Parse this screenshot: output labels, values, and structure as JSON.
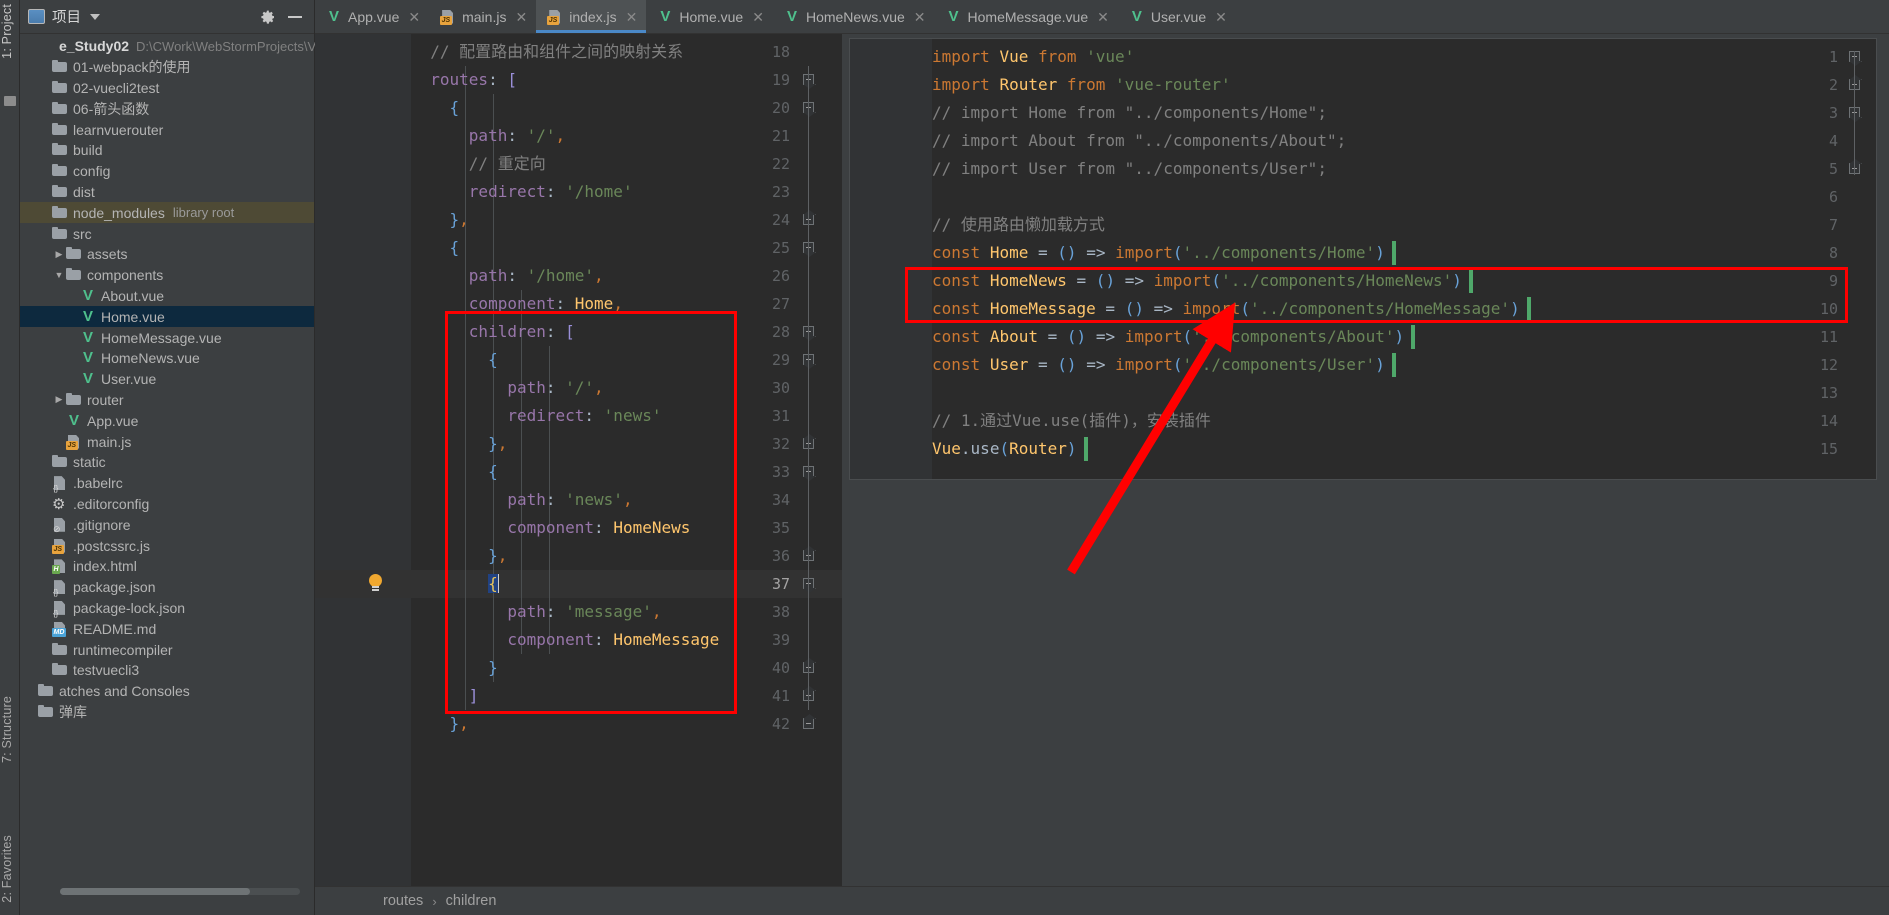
{
  "left_strip": {
    "project_tab": "1: Project",
    "structure_tab": "7: Structure",
    "favorites_tab": "2: Favorites"
  },
  "project_panel": {
    "title": "项目",
    "icons": {
      "project": "project-icon",
      "caret": "chevron-down-icon",
      "settings": "gear-icon",
      "hide": "minimize-icon"
    },
    "tree": [
      {
        "label": "e_Study02",
        "note": "D:\\CWork\\WebStormProjects\\Vue_Stu",
        "icon": "folder-icon",
        "indent": 0,
        "arrow": "",
        "kind": "root"
      },
      {
        "label": "01-webpack的使用",
        "icon": "folder-icon",
        "indent": 1,
        "arrow": "",
        "kind": "folder"
      },
      {
        "label": "02-vuecli2test",
        "icon": "folder-icon",
        "indent": 1,
        "arrow": "",
        "kind": "folder"
      },
      {
        "label": "06-箭头函数",
        "icon": "folder-icon",
        "indent": 1,
        "arrow": "",
        "kind": "folder"
      },
      {
        "label": "learnvuerouter",
        "icon": "folder-icon",
        "indent": 1,
        "arrow": "",
        "kind": "folder"
      },
      {
        "label": "build",
        "icon": "folder-icon",
        "indent": 1,
        "arrow": "",
        "kind": "folder"
      },
      {
        "label": "config",
        "icon": "folder-icon",
        "indent": 1,
        "arrow": "",
        "kind": "folder"
      },
      {
        "label": "dist",
        "icon": "folder-icon",
        "indent": 1,
        "arrow": "",
        "kind": "folder"
      },
      {
        "label": "node_modules",
        "note": "library root",
        "icon": "folder-icon",
        "indent": 1,
        "arrow": "",
        "kind": "library"
      },
      {
        "label": "src",
        "icon": "folder-icon",
        "indent": 1,
        "arrow": "",
        "kind": "folder"
      },
      {
        "label": "assets",
        "icon": "folder-icon",
        "indent": 2,
        "arrow": "▶",
        "kind": "folder"
      },
      {
        "label": "components",
        "icon": "folder-icon",
        "indent": 2,
        "arrow": "▼",
        "kind": "folder"
      },
      {
        "label": "About.vue",
        "icon": "vue-icon",
        "indent": 3,
        "arrow": "",
        "kind": "vue"
      },
      {
        "label": "Home.vue",
        "icon": "vue-icon",
        "indent": 3,
        "arrow": "",
        "kind": "vue",
        "selected": true
      },
      {
        "label": "HomeMessage.vue",
        "icon": "vue-icon",
        "indent": 3,
        "arrow": "",
        "kind": "vue"
      },
      {
        "label": "HomeNews.vue",
        "icon": "vue-icon",
        "indent": 3,
        "arrow": "",
        "kind": "vue"
      },
      {
        "label": "User.vue",
        "icon": "vue-icon",
        "indent": 3,
        "arrow": "",
        "kind": "vue"
      },
      {
        "label": "router",
        "icon": "folder-icon",
        "indent": 2,
        "arrow": "▶",
        "kind": "folder"
      },
      {
        "label": "App.vue",
        "icon": "vue-icon",
        "indent": 2,
        "arrow": "",
        "kind": "vue"
      },
      {
        "label": "main.js",
        "icon": "js-file-icon",
        "indent": 2,
        "arrow": "",
        "kind": "js"
      },
      {
        "label": "static",
        "icon": "folder-icon",
        "indent": 1,
        "arrow": "",
        "kind": "folder"
      },
      {
        "label": ".babelrc",
        "icon": "json-file-icon",
        "indent": 1,
        "arrow": "",
        "kind": "json"
      },
      {
        "label": ".editorconfig",
        "icon": "gear-file-icon",
        "indent": 1,
        "arrow": "",
        "kind": "gear"
      },
      {
        "label": ".gitignore",
        "icon": "gitignore-file-icon",
        "indent": 1,
        "arrow": "",
        "kind": "gitignore"
      },
      {
        "label": ".postcssrc.js",
        "icon": "js-file-icon",
        "indent": 1,
        "arrow": "",
        "kind": "js"
      },
      {
        "label": "index.html",
        "icon": "html-file-icon",
        "indent": 1,
        "arrow": "",
        "kind": "html"
      },
      {
        "label": "package.json",
        "icon": "json-file-icon",
        "indent": 1,
        "arrow": "",
        "kind": "json"
      },
      {
        "label": "package-lock.json",
        "icon": "json-file-icon",
        "indent": 1,
        "arrow": "",
        "kind": "json"
      },
      {
        "label": "README.md",
        "icon": "md-file-icon",
        "indent": 1,
        "arrow": "",
        "kind": "md"
      },
      {
        "label": "runtimecompiler",
        "icon": "folder-icon",
        "indent": 1,
        "arrow": "",
        "kind": "folder"
      },
      {
        "label": "testvuecli3",
        "icon": "folder-icon",
        "indent": 1,
        "arrow": "",
        "kind": "folder"
      },
      {
        "label": "atches and Consoles",
        "icon": "folder-icon",
        "indent": 0,
        "arrow": "",
        "kind": "folder"
      },
      {
        "label": "弹库",
        "icon": "folder-icon",
        "indent": 0,
        "arrow": "",
        "kind": "folder"
      }
    ]
  },
  "editor_tabs": [
    {
      "label": "App.vue",
      "icon": "vue-icon",
      "active": false
    },
    {
      "label": "main.js",
      "icon": "js-file-icon",
      "active": false
    },
    {
      "label": "index.js",
      "icon": "js-file-icon",
      "active": true
    },
    {
      "label": "Home.vue",
      "icon": "vue-icon",
      "active": false
    },
    {
      "label": "HomeNews.vue",
      "icon": "vue-icon",
      "active": false
    },
    {
      "label": "HomeMessage.vue",
      "icon": "vue-icon",
      "active": false
    },
    {
      "label": "User.vue",
      "icon": "vue-icon",
      "active": false
    }
  ],
  "left_pane": {
    "first_line_number": 18,
    "current_line": 37,
    "lines": [
      {
        "n": 18,
        "text": "  // 配置路由和组件之间的映射关系"
      },
      {
        "n": 19,
        "text": "  routes: ["
      },
      {
        "n": 20,
        "text": "    {"
      },
      {
        "n": 21,
        "text": "      path: '/',"
      },
      {
        "n": 22,
        "text": "      // 重定向"
      },
      {
        "n": 23,
        "text": "      redirect: '/home'"
      },
      {
        "n": 24,
        "text": "    },"
      },
      {
        "n": 25,
        "text": "    {"
      },
      {
        "n": 26,
        "text": "      path: '/home',"
      },
      {
        "n": 27,
        "text": "      component: Home,"
      },
      {
        "n": 28,
        "text": "      children: ["
      },
      {
        "n": 29,
        "text": "        {"
      },
      {
        "n": 30,
        "text": "          path: '/',"
      },
      {
        "n": 31,
        "text": "          redirect: 'news'"
      },
      {
        "n": 32,
        "text": "        },"
      },
      {
        "n": 33,
        "text": "        {"
      },
      {
        "n": 34,
        "text": "          path: 'news',"
      },
      {
        "n": 35,
        "text": "          component: HomeNews"
      },
      {
        "n": 36,
        "text": "        },"
      },
      {
        "n": 37,
        "text": "        {"
      },
      {
        "n": 38,
        "text": "          path: 'message',"
      },
      {
        "n": 39,
        "text": "          component: HomeMessage"
      },
      {
        "n": 40,
        "text": "        }"
      },
      {
        "n": 41,
        "text": "      ]"
      },
      {
        "n": 42,
        "text": "    },"
      }
    ]
  },
  "right_pane": {
    "lines": [
      {
        "n": 1,
        "text": "import Vue from 'vue'"
      },
      {
        "n": 2,
        "text": "import Router from 'vue-router'"
      },
      {
        "n": 3,
        "text": "// import Home from \"../components/Home\";"
      },
      {
        "n": 4,
        "text": "// import About from \"../components/About\";"
      },
      {
        "n": 5,
        "text": "// import User from \"../components/User\";"
      },
      {
        "n": 6,
        "text": ""
      },
      {
        "n": 7,
        "text": "// 使用路由懒加载方式"
      },
      {
        "n": 8,
        "text": "const Home = () => import('../components/Home')"
      },
      {
        "n": 9,
        "text": "const HomeNews = () => import('../components/HomeNews')"
      },
      {
        "n": 10,
        "text": "const HomeMessage = () => import('../components/HomeMessage')"
      },
      {
        "n": 11,
        "text": "const About = () => import('../components/About')"
      },
      {
        "n": 12,
        "text": "const User = () => import('../components/User')"
      },
      {
        "n": 13,
        "text": ""
      },
      {
        "n": 14,
        "text": "// 1.通过Vue.use(插件)，安装插件"
      },
      {
        "n": 15,
        "text": "Vue.use(Router)"
      }
    ]
  },
  "annotations": {
    "red_box_left_label": "children-array-highlight",
    "red_box_right_label": "lazy-import-highlight",
    "arrow_label": "red-arrow-connector",
    "color": "#ff0000"
  },
  "breadcrumb": {
    "items": [
      "routes",
      "children"
    ],
    "separator": "›"
  },
  "theme": {
    "bg": "#2b2b2b",
    "panel_bg": "#3c3f41",
    "gutter_bg": "#313335",
    "accent": "#4a88c7",
    "selection": "#0d293e",
    "vue_green": "#4fc08d",
    "library_root": "#4e4a35"
  }
}
